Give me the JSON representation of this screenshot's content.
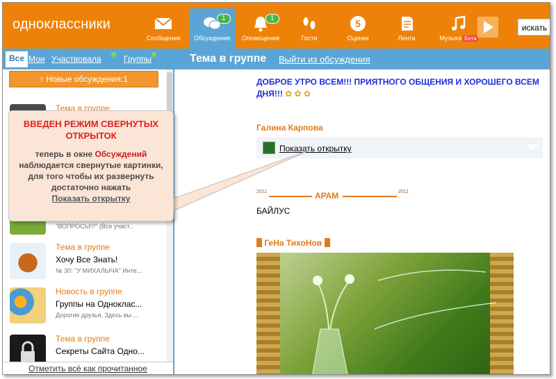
{
  "header": {
    "logo": "одноклассники",
    "nav": [
      {
        "label": "Сообщения",
        "icon": "envelope-icon",
        "badge": ""
      },
      {
        "label": "Обсуждения",
        "icon": "chat-icon",
        "badge": "1",
        "active": true
      },
      {
        "label": "Оповещения",
        "icon": "bell-icon",
        "badge": "1"
      },
      {
        "label": "Гости",
        "icon": "footprints-icon",
        "badge": ""
      },
      {
        "label": "Оценки",
        "icon": "rating-5-icon",
        "badge": "5"
      },
      {
        "label": "Лента",
        "icon": "feed-icon",
        "badge": ""
      },
      {
        "label": "Музыка",
        "icon": "music-note-icon",
        "badge": "",
        "beta": "Бета"
      }
    ],
    "search_button": "искать"
  },
  "left": {
    "tabs": [
      "Все",
      "Мои",
      "Участвовала",
      "Группы"
    ],
    "new_discussions": "↑ Новые обсуждения:1",
    "items": [
      {
        "kind": "Тема в группе",
        "title": "",
        "sub": ""
      },
      {
        "kind": "",
        "title": "",
        "sub": "\"ВОПРОСЫ!!!\" (Все участ..."
      },
      {
        "kind": "Тема в группе",
        "title": "Хочу Все Знать!",
        "sub": "№ 30: \"У МИХАЛЫЧА\" Инте..."
      },
      {
        "kind": "Новость в группе",
        "title": "Группы на Одноклас...",
        "sub": "Дорогие друзья, Здесь вы ..."
      },
      {
        "kind": "Тема в группе",
        "title": "Секреты Сайта Одно...",
        "sub": ""
      }
    ],
    "mark_all": "Отметить всё как прочитанное"
  },
  "right": {
    "title": "Тема в группе",
    "leave": "Выйти из обсуждения",
    "greeting": "ДОБРОЕ УТРО ВСЕМ!!! ПРИЯТНОГО ОБЩЕНИЯ И ХОРОШЕГО ВСЕМ ДНЯ!!!",
    "author1": "Галина Карпова",
    "show_card": "Показать открытку",
    "author2": "АРАМ",
    "year": "2011",
    "author2_text": "БАЙЛУС",
    "author3": "ГеНа ТихоНов"
  },
  "callout": {
    "title": "ВВЕДЕН РЕЖИМ СВЕРНУТЫХ ОТКРЫТОК",
    "body_pre": "теперь в окне ",
    "body_highlight": "Обсуждений",
    "body_post": " наблюдается свернутые картинки, для того чтобы их развернуть достаточно нажать",
    "link": "Показать открытку"
  },
  "colors": {
    "orange": "#ee8208",
    "blue": "#5aa5d6",
    "green_badge": "#48b34a"
  }
}
